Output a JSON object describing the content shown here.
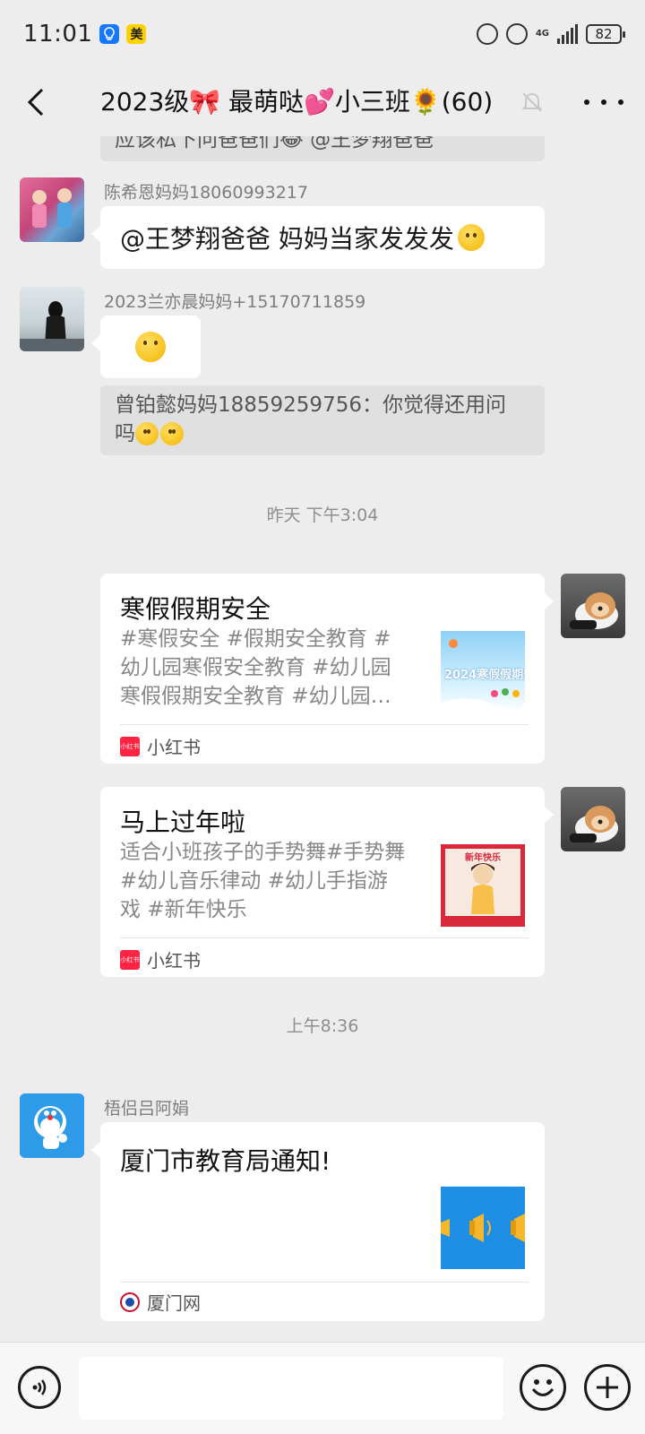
{
  "status_bar": {
    "time": "11:01",
    "badge_meituan": "美",
    "network": "4G",
    "battery": "82"
  },
  "header": {
    "title": "2023级🎀 最萌哒💕小三班🌻(60)"
  },
  "messages": {
    "quote_top": "应该私下问爸爸们😂 @王梦翔爸爸",
    "m1": {
      "sender": "陈希恩妈妈18060993217",
      "text": "@王梦翔爸爸  妈妈当家发发发"
    },
    "m2": {
      "sender": "2023兰亦晨妈妈+15170711859",
      "quote_line1": "曾铂懿妈妈18859259756：你觉得还用问",
      "quote_line2": "吗"
    },
    "ts1": "昨天 下午3:04",
    "card1": {
      "title": "寒假假期安全",
      "desc": [
        "#寒假安全  #假期安全教育  #",
        "幼儿园寒假安全教育  #幼儿园",
        "寒假假期安全教育  #幼儿园…"
      ],
      "thumb_text": "2024寒假假期安全",
      "source": "小红书",
      "source_logo_text": "小红书"
    },
    "card2": {
      "title": "马上过年啦",
      "desc": [
        "适合小班孩子的手势舞#手势舞",
        "#幼儿音乐律动  #幼儿手指游",
        "戏  #新年快乐"
      ],
      "thumb_text": "新年快乐",
      "source": "小红书",
      "source_logo_text": "小红书"
    },
    "ts2": "上午8:36",
    "m3": {
      "sender": "梧侣吕阿娟",
      "card_title": "厦门市教育局通知!",
      "source": "厦门网"
    }
  },
  "input": {
    "value": "",
    "placeholder": ""
  },
  "colors": {
    "background": "#ededed",
    "bubble": "#ffffff",
    "quote": "#e0e0e0",
    "xhs_red": "#ff2442"
  }
}
